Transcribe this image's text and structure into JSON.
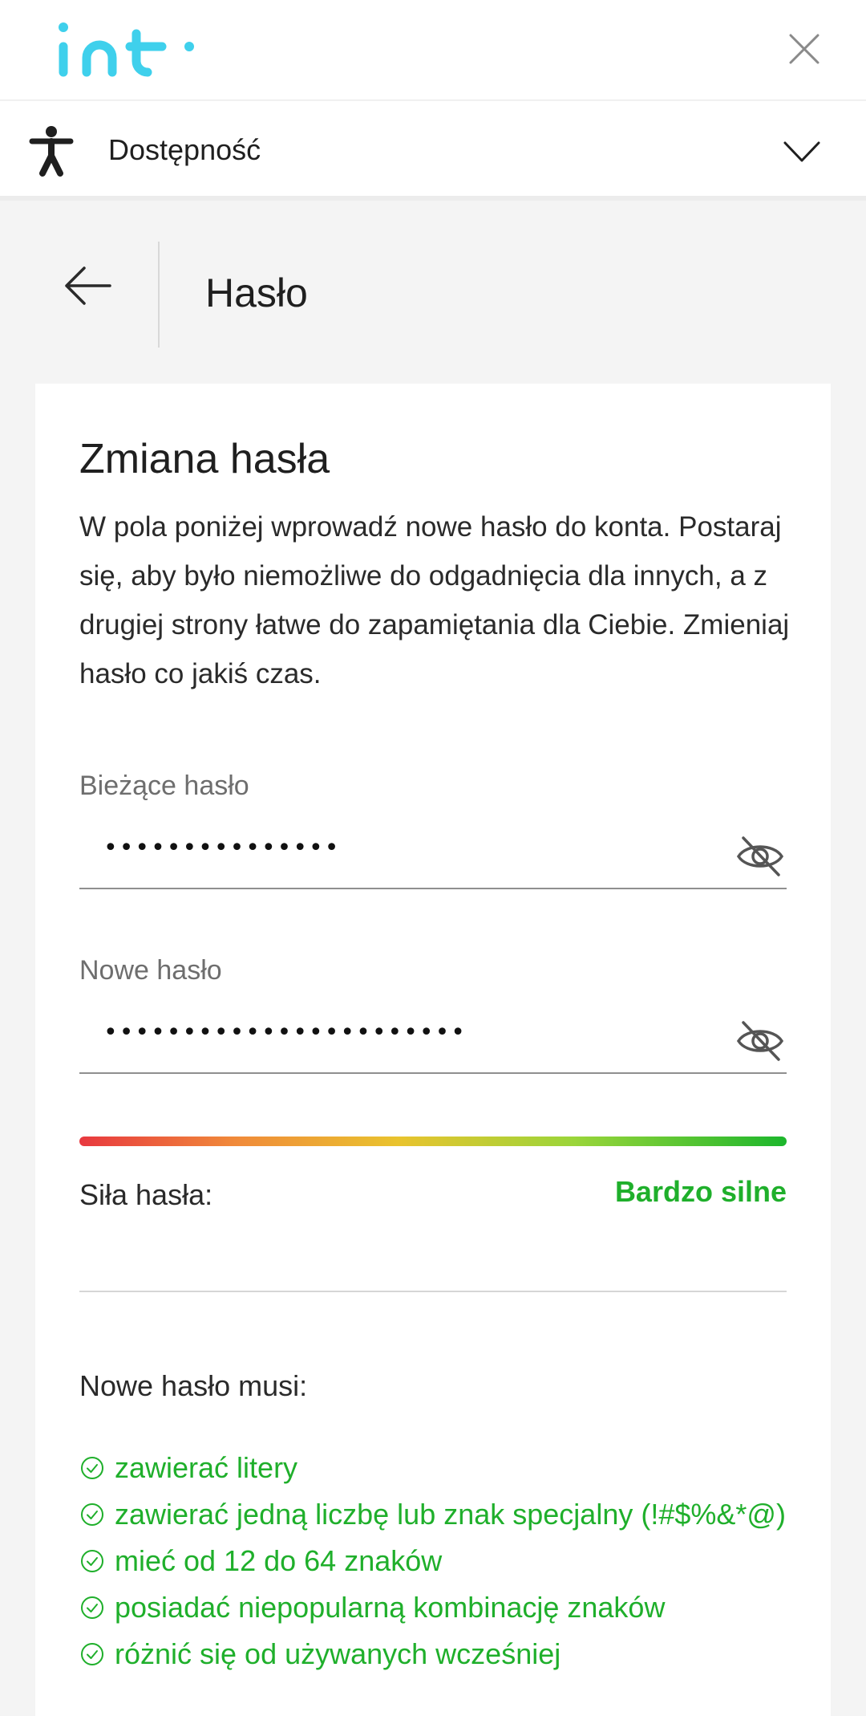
{
  "header": {
    "logo_text": "int",
    "close_icon": "close-icon"
  },
  "accessibility": {
    "label": "Dostępność",
    "icon": "accessibility-person-icon",
    "chevron": "chevron-down-icon"
  },
  "page": {
    "title": "Hasło",
    "back_icon": "arrow-left-icon"
  },
  "card": {
    "title": "Zmiana hasła",
    "description": "W pola poniżej wprowadź nowe hasło do konta. Postaraj się, aby było niemożliwe do odgadnięcia dla innych, a z drugiej strony łatwe do zapamiętania dla Ciebie. Zmieniaj hasło co jakiś czas.",
    "current_password": {
      "label": "Bieżące hasło",
      "value": "•••••••••••••••",
      "icon": "eye-off-icon"
    },
    "new_password": {
      "label": "Nowe hasło",
      "value": "•••••••••••••••••••••••",
      "icon": "eye-off-icon"
    },
    "strength": {
      "label": "Siła hasła:",
      "value": "Bardzo silne",
      "value_color": "#1faf2b",
      "level": 1.0
    },
    "requirements": {
      "title": "Nowe hasło musi:",
      "icon": "check-circle-icon",
      "color": "#1faf2b",
      "items": [
        "zawierać litery",
        "zawierać jedną liczbę lub znak specjalny (!#$%&*@)",
        "mieć od 12 do 64 znaków",
        "posiadać niepopularną kombinację znaków",
        "różnić się od używanych wcześniej"
      ]
    }
  }
}
